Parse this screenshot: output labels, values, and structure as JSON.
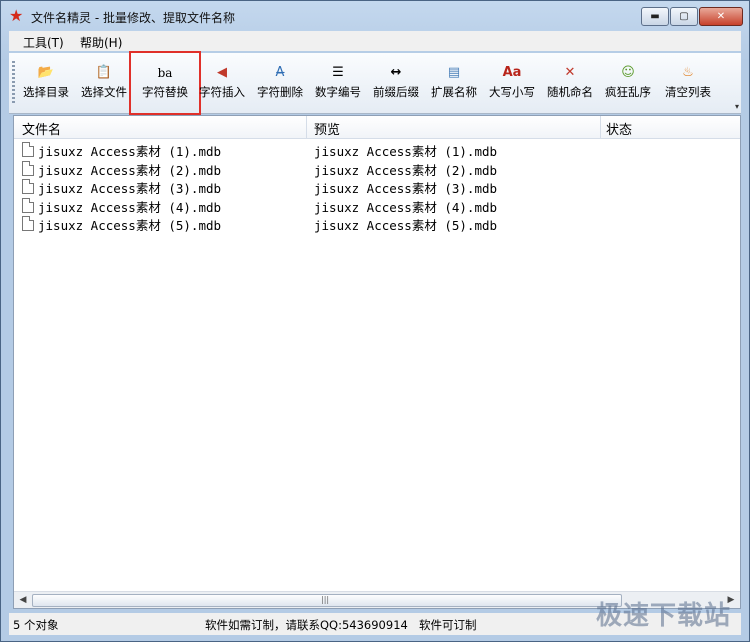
{
  "window": {
    "title": "文件名精灵 - 批量修改、提取文件名称",
    "app_icon": "★",
    "controls": {
      "minimize": "▬",
      "maximize": "▢",
      "close": "✕"
    }
  },
  "menu": [
    {
      "label": "工具(T)"
    },
    {
      "label": "帮助(H)"
    }
  ],
  "toolbar": {
    "buttons": [
      {
        "label": "选择目录",
        "icon": "folder-open-icon",
        "glyph": "📂"
      },
      {
        "label": "选择文件",
        "icon": "file-select-icon",
        "glyph": "📋"
      },
      {
        "label": "字符替换",
        "icon": "replace-text-icon",
        "glyph": "ba",
        "highlighted": true
      },
      {
        "label": "字符插入",
        "icon": "insert-text-icon",
        "glyph": "◀"
      },
      {
        "label": "字符删除",
        "icon": "delete-text-icon",
        "glyph": "A̶"
      },
      {
        "label": "数字编号",
        "icon": "numbered-list-icon",
        "glyph": "☰"
      },
      {
        "label": "前缀后缀",
        "icon": "prefix-suffix-icon",
        "glyph": "↔"
      },
      {
        "label": "扩展名称",
        "icon": "extension-icon",
        "glyph": "▤"
      },
      {
        "label": "大写小写",
        "icon": "case-icon",
        "glyph": "Aa"
      },
      {
        "label": "随机命名",
        "icon": "shuffle-icon",
        "glyph": "✕"
      },
      {
        "label": "疯狂乱序",
        "icon": "crazy-face-icon",
        "glyph": "☺"
      },
      {
        "label": "清空列表",
        "icon": "clear-list-icon",
        "glyph": "♨"
      }
    ],
    "overflow": "▾"
  },
  "list": {
    "columns": [
      "文件名",
      "预览",
      "状态"
    ],
    "rows": [
      {
        "name": "jisuxz Access素材 (1).mdb",
        "preview": "jisuxz Access素材 (1).mdb",
        "status": ""
      },
      {
        "name": "jisuxz Access素材 (2).mdb",
        "preview": "jisuxz Access素材 (2).mdb",
        "status": ""
      },
      {
        "name": "jisuxz Access素材 (3).mdb",
        "preview": "jisuxz Access素材 (3).mdb",
        "status": ""
      },
      {
        "name": "jisuxz Access素材 (4).mdb",
        "preview": "jisuxz Access素材 (4).mdb",
        "status": ""
      },
      {
        "name": "jisuxz Access素材 (5).mdb",
        "preview": "jisuxz Access素材 (5).mdb",
        "status": ""
      }
    ],
    "scrollbar": {
      "left": "◀",
      "right": "▶",
      "grip": "|||"
    }
  },
  "statusbar": {
    "count": "5 个对象",
    "contact": "软件如需订制，请联系QQ:543690914",
    "custom": "软件可订制"
  },
  "watermark": "极速下载站"
}
